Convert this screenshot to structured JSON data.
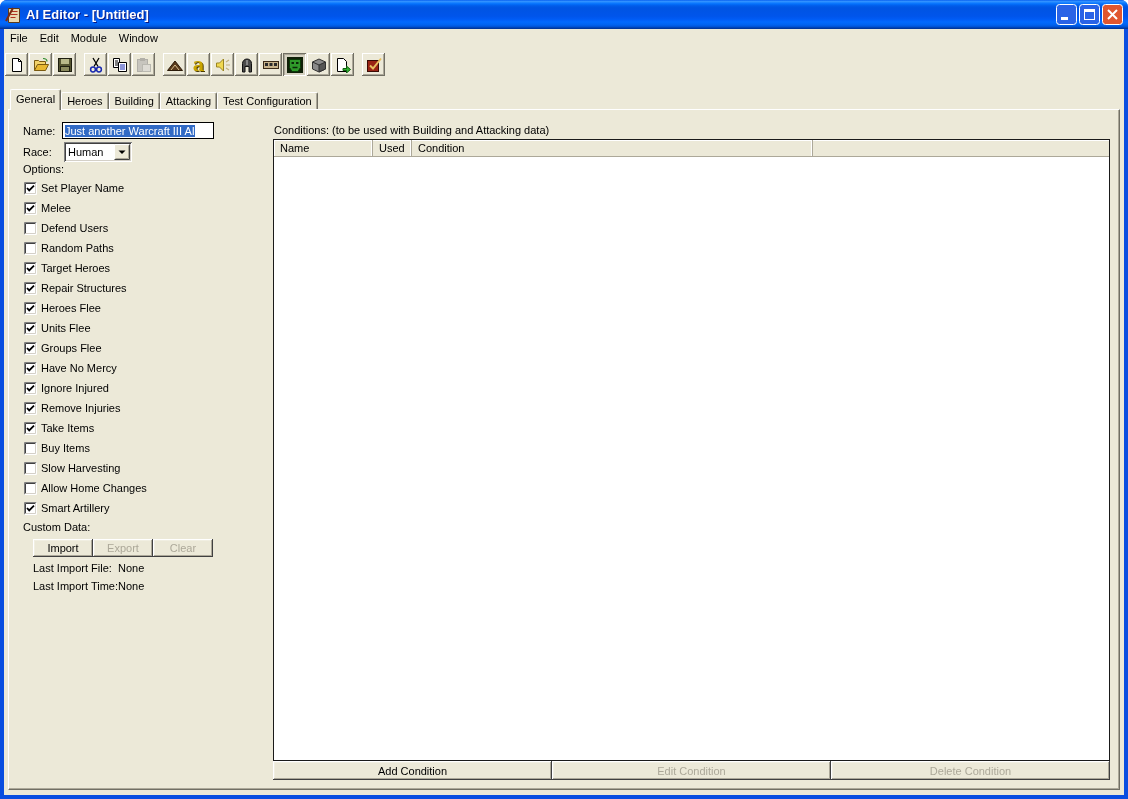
{
  "window": {
    "title": "AI Editor - [Untitled]"
  },
  "menu": [
    "File",
    "Edit",
    "Module",
    "Window"
  ],
  "toolbar": [
    [
      {
        "kind": "new",
        "disabled": false,
        "pressed": false
      },
      {
        "kind": "open",
        "disabled": false,
        "pressed": false
      },
      {
        "kind": "save",
        "disabled": false,
        "pressed": false
      }
    ],
    [
      {
        "kind": "cut",
        "disabled": false,
        "pressed": false
      },
      {
        "kind": "copy",
        "disabled": false,
        "pressed": false
      },
      {
        "kind": "paste",
        "disabled": true,
        "pressed": false
      }
    ],
    [
      {
        "kind": "mound",
        "disabled": false,
        "pressed": false
      },
      {
        "kind": "letter",
        "text": "a",
        "disabled": false,
        "pressed": false
      },
      {
        "kind": "speaker",
        "disabled": false,
        "pressed": false
      },
      {
        "kind": "helmet",
        "disabled": false,
        "pressed": false
      },
      {
        "kind": "panel",
        "disabled": false,
        "pressed": false
      },
      {
        "kind": "face",
        "disabled": false,
        "pressed": true
      },
      {
        "kind": "cube",
        "disabled": false,
        "pressed": false
      },
      {
        "kind": "doc_arrow",
        "disabled": false,
        "pressed": false
      }
    ],
    [
      {
        "kind": "check_box",
        "disabled": false,
        "pressed": false
      }
    ]
  ],
  "tabs": [
    {
      "label": "General",
      "selected": true
    },
    {
      "label": "Heroes",
      "selected": false
    },
    {
      "label": "Building",
      "selected": false
    },
    {
      "label": "Attacking",
      "selected": false
    },
    {
      "label": "Test Configuration",
      "selected": false
    }
  ],
  "general": {
    "name": {
      "label": "Name:",
      "value": "Just another Warcraft III AI",
      "text_selected": true
    },
    "race": {
      "label": "Race:",
      "value": "Human"
    },
    "options_label": "Options:",
    "options": [
      {
        "label": "Set Player Name",
        "checked": true
      },
      {
        "label": "Melee",
        "checked": true
      },
      {
        "label": "Defend Users",
        "checked": false
      },
      {
        "label": "Random Paths",
        "checked": false
      },
      {
        "label": "Target Heroes",
        "checked": true
      },
      {
        "label": "Repair Structures",
        "checked": true
      },
      {
        "label": "Heroes Flee",
        "checked": true
      },
      {
        "label": "Units Flee",
        "checked": true
      },
      {
        "label": "Groups Flee",
        "checked": true
      },
      {
        "label": "Have No Mercy",
        "checked": true
      },
      {
        "label": "Ignore Injured",
        "checked": true
      },
      {
        "label": "Remove Injuries",
        "checked": true
      },
      {
        "label": "Take Items",
        "checked": true
      },
      {
        "label": "Buy Items",
        "checked": false
      },
      {
        "label": "Slow Harvesting",
        "checked": false
      },
      {
        "label": "Allow Home Changes",
        "checked": false
      },
      {
        "label": "Smart Artillery",
        "checked": true
      }
    ],
    "custom_data": {
      "label": "Custom Data:",
      "buttons": [
        {
          "label": "Import",
          "disabled": false
        },
        {
          "label": "Export",
          "disabled": true
        },
        {
          "label": "Clear",
          "disabled": true
        }
      ],
      "info": [
        {
          "label": "Last Import File:",
          "value": "None"
        },
        {
          "label": "Last Import Time:",
          "value": "None"
        }
      ]
    }
  },
  "conditions": {
    "label": "Conditions: (to be used with Building and Attacking data)",
    "columns": [
      "Name",
      "Used",
      "Condition"
    ],
    "buttons": [
      {
        "label": "Add Condition",
        "disabled": false
      },
      {
        "label": "Edit Condition",
        "disabled": true
      },
      {
        "label": "Delete Condition",
        "disabled": true
      }
    ]
  }
}
